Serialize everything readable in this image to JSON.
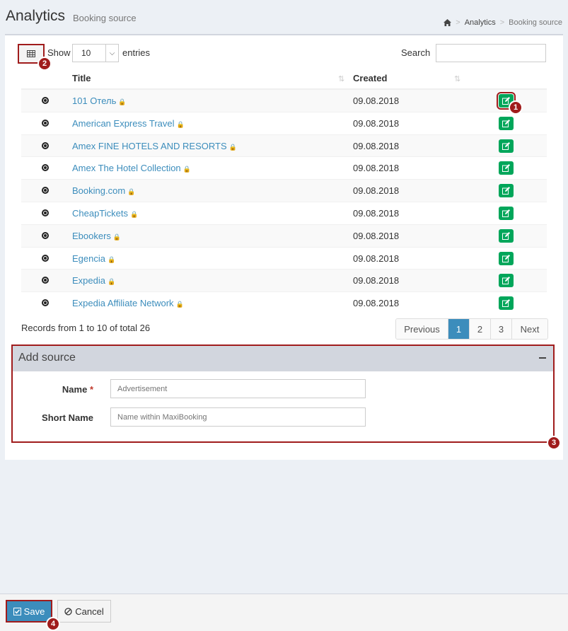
{
  "header": {
    "title": "Analytics",
    "subtitle": "Booking source",
    "breadcrumb": [
      "Analytics",
      "Booking source"
    ]
  },
  "toolbar": {
    "show_label": "Show",
    "entries_value": "10",
    "entries_label": "entries",
    "search_label": "Search",
    "search_value": ""
  },
  "table": {
    "columns": [
      "Title",
      "Created"
    ],
    "rows": [
      {
        "title": "101 Отель",
        "created": "09.08.2018"
      },
      {
        "title": "American Express Travel",
        "created": "09.08.2018"
      },
      {
        "title": "Amex FINE HOTELS AND RESORTS",
        "created": "09.08.2018"
      },
      {
        "title": "Amex The Hotel Collection",
        "created": "09.08.2018"
      },
      {
        "title": "Booking.com",
        "created": "09.08.2018"
      },
      {
        "title": "CheapTickets",
        "created": "09.08.2018"
      },
      {
        "title": "Ebookers",
        "created": "09.08.2018"
      },
      {
        "title": "Egencia",
        "created": "09.08.2018"
      },
      {
        "title": "Expedia",
        "created": "09.08.2018"
      },
      {
        "title": "Expedia Affiliate Network",
        "created": "09.08.2018"
      }
    ]
  },
  "records_text": "Records from 1 to 10 of total 26",
  "pagination": {
    "previous": "Previous",
    "pages": [
      "1",
      "2",
      "3"
    ],
    "active": "1",
    "next": "Next"
  },
  "add_source": {
    "title": "Add source",
    "name_label": "Name",
    "required_mark": "*",
    "name_placeholder": "Advertisement",
    "short_name_label": "Short Name",
    "short_name_placeholder": "Name within MaxiBooking"
  },
  "markers": [
    "1",
    "2",
    "3",
    "4"
  ],
  "footer": {
    "save_label": "Save",
    "cancel_label": "Cancel"
  },
  "colors": {
    "link": "#3c8dbc",
    "edit_button": "#00a65a",
    "primary": "#3c8dbc",
    "highlight": "#a01c1c"
  }
}
